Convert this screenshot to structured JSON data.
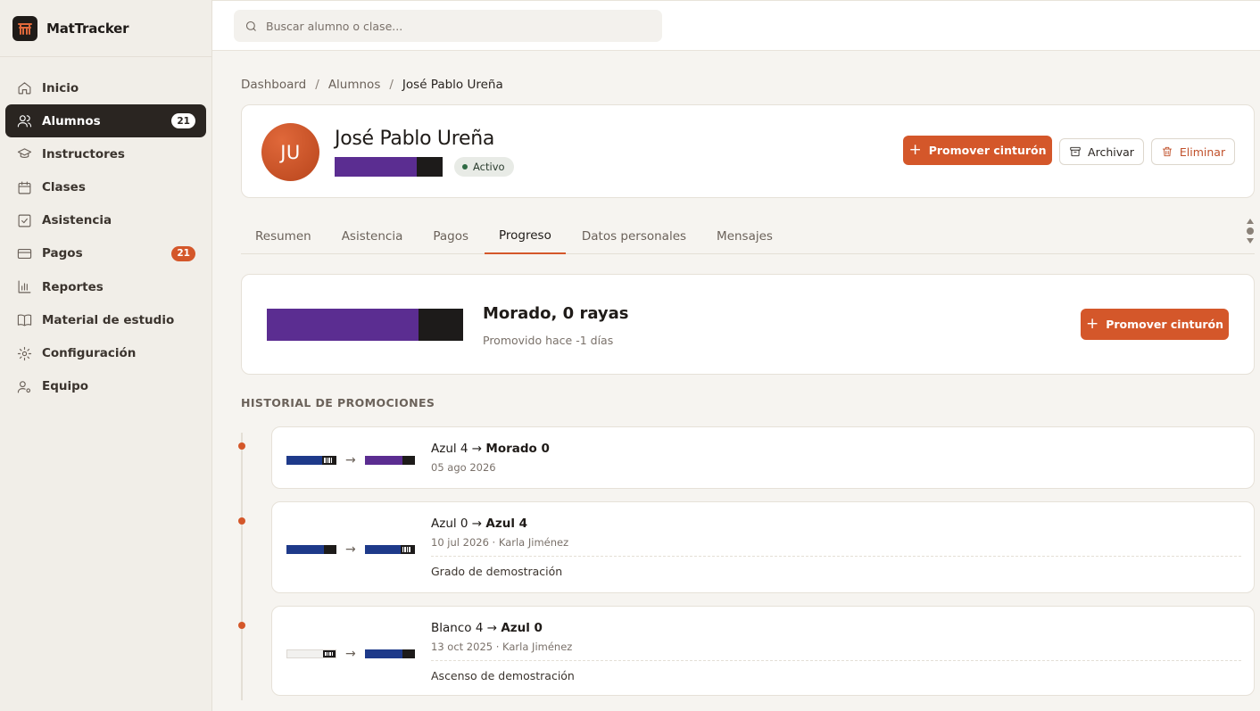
{
  "app": {
    "name": "MatTracker"
  },
  "search": {
    "placeholder": "Buscar alumno o clase..."
  },
  "sidebar": {
    "items": [
      {
        "label": "Inicio",
        "icon": "home-icon"
      },
      {
        "label": "Alumnos",
        "icon": "users-icon",
        "badge": "21",
        "active": true
      },
      {
        "label": "Instructores",
        "icon": "graduation-cap-icon"
      },
      {
        "label": "Clases",
        "icon": "calendar-icon"
      },
      {
        "label": "Asistencia",
        "icon": "checkbox-icon"
      },
      {
        "label": "Pagos",
        "icon": "credit-card-icon",
        "badge": "21"
      },
      {
        "label": "Reportes",
        "icon": "bar-chart-icon"
      },
      {
        "label": "Material de estudio",
        "icon": "book-icon"
      },
      {
        "label": "Configuración",
        "icon": "gear-icon"
      },
      {
        "label": "Equipo",
        "icon": "user-cog-icon"
      }
    ]
  },
  "breadcrumb": {
    "items": [
      "Dashboard",
      "Alumnos",
      "José Pablo Ureña"
    ]
  },
  "profile": {
    "initials": "JU",
    "name": "José Pablo Ureña",
    "status": "Activo",
    "belt_color": "#5b2d91",
    "promote_label": "Promover cinturón",
    "archive_label": "Archivar",
    "delete_label": "Eliminar"
  },
  "tabs": [
    "Resumen",
    "Asistencia",
    "Pagos",
    "Progreso",
    "Datos personales",
    "Mensajes"
  ],
  "active_tab": "Progreso",
  "current_belt": {
    "title": "Morado, 0 rayas",
    "subtitle": "Promovido hace -1 días",
    "color": "#5b2d91",
    "promote_label": "Promover cinturón"
  },
  "history": {
    "title": "HISTORIAL DE PROMOCIONES",
    "items": [
      {
        "from": "Azul 4",
        "to": "Morado 0",
        "meta": "05 ago 2026",
        "note": "",
        "from_color": "#1e3a8a",
        "from_stripes": 4,
        "to_color": "#5b2d91",
        "to_stripes": 0
      },
      {
        "from": "Azul 0",
        "to": "Azul 4",
        "meta": "10 jul 2026 · Karla Jiménez",
        "note": "Grado de demostración",
        "from_color": "#1e3a8a",
        "from_stripes": 0,
        "to_color": "#1e3a8a",
        "to_stripes": 4
      },
      {
        "from": "Blanco 4",
        "to": "Azul 0",
        "meta": "13 oct 2025 · Karla Jiménez",
        "note": "Ascenso de demostración",
        "from_color": "#f2f1ef",
        "from_stripes": 4,
        "to_color": "#1e3a8a",
        "to_stripes": 0
      }
    ]
  },
  "colors": {
    "accent": "#d4572a",
    "sidebar_active": "#2a2521"
  }
}
